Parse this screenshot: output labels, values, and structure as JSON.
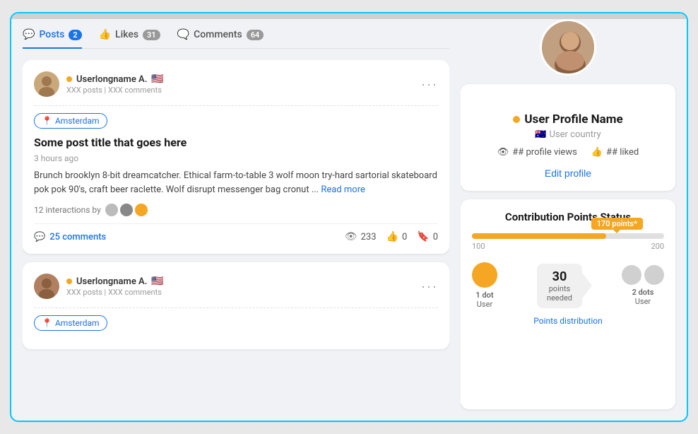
{
  "tabs": [
    {
      "id": "posts",
      "label": "Posts",
      "badge": "2",
      "active": true,
      "icon": "💬"
    },
    {
      "id": "likes",
      "label": "Likes",
      "badge": "31",
      "active": false,
      "icon": "👍"
    },
    {
      "id": "comments",
      "label": "Comments",
      "badge": "64",
      "active": false,
      "icon": "🗨️"
    }
  ],
  "posts": [
    {
      "id": 1,
      "author": "Userlongname A.",
      "flag": "🇺🇸",
      "meta": "XXX posts | XXX comments",
      "tag": "Amsterdam",
      "title": "Some post title that goes here",
      "time": "3 hours ago",
      "body": "Brunch brooklyn 8-bit dreamcatcher. Ethical farm-to-table 3 wolf moon try-hard sartorial skateboard pok pok 90's, craft beer raclette. Wolf disrupt messenger bag cronut ...",
      "read_more": "Read more",
      "interactions_text": "12 interactions by",
      "comments_count": "25 comments",
      "views": "233",
      "likes": "0",
      "bookmarks": "0"
    },
    {
      "id": 2,
      "author": "Userlongname A.",
      "flag": "🇺🇸",
      "meta": "XXX posts | XXX comments",
      "tag": "Amsterdam",
      "title": "",
      "time": "",
      "body": "",
      "read_more": "",
      "interactions_text": "",
      "comments_count": "",
      "views": "",
      "likes": "",
      "bookmarks": ""
    }
  ],
  "profile": {
    "name": "User Profile Name",
    "country": "User country",
    "country_flag": "🇦🇺",
    "profile_views_icon": "👁",
    "profile_views": "## profile views",
    "liked_icon": "👍",
    "liked": "## liked",
    "edit_label": "Edit profile"
  },
  "contribution": {
    "title": "Contribution Points Status",
    "tooltip": "170 points*",
    "progress_min": "100",
    "progress_max": "200",
    "progress_percent": 70,
    "levels": [
      {
        "label": "1 dot",
        "sublabel": "User",
        "type": "orange"
      },
      {
        "points": "30",
        "needed": "points\nneeded"
      },
      {
        "label": "2 dots",
        "sublabel": "User",
        "type": "light-gray"
      }
    ],
    "points_distribution": "Points distribution"
  }
}
